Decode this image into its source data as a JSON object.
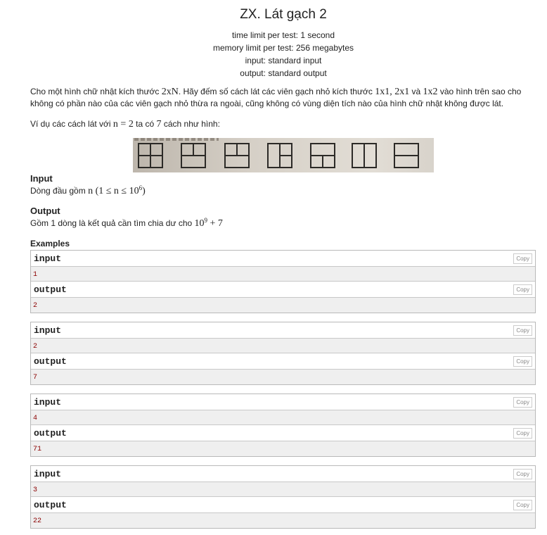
{
  "problem": {
    "title": "ZX. Lát gạch 2",
    "limits": [
      "time limit per test: 1 second",
      "memory limit per test: 256 megabytes",
      "input: standard input",
      "output: standard output"
    ],
    "statement": {
      "p1_a": "Cho một hình chữ nhật kích thước ",
      "p1_math1": "2xN",
      "p1_b": ". Hãy đếm số cách lát các viên gạch nhỏ kích thước ",
      "p1_math2": "1x1, 2x1",
      "p1_c": " và ",
      "p1_math3": "1x2",
      "p1_d": " vào hình trên sao cho không có phần nào của các viên gạch nhỏ thừa ra ngoài, cũng không có vùng diện tích nào của hình chữ nhật không được lát.",
      "p2_a": "Ví dụ các cách lát với ",
      "p2_math1": "n = 2",
      "p2_b": " ta có ",
      "p2_math2": "7",
      "p2_c": " cách như hình:"
    },
    "input_section": {
      "heading": "Input",
      "text_a": "Dòng đầu gồm ",
      "math_a": "n (1 ≤ n ≤ 10",
      "sup": "6",
      "math_b": ")"
    },
    "output_section": {
      "heading": "Output",
      "text_a": "Gồm 1 dòng là kết quả cần tìm chia dư cho ",
      "math_a": "10",
      "sup": "9",
      "math_b": " + 7"
    },
    "examples_heading": "Examples",
    "copy_label": "Copy",
    "input_label": "input",
    "output_label": "output",
    "examples": [
      {
        "input": "1",
        "output": "2"
      },
      {
        "input": "2",
        "output": "7"
      },
      {
        "input": "4",
        "output": "71"
      },
      {
        "input": "3",
        "output": "22"
      }
    ]
  }
}
